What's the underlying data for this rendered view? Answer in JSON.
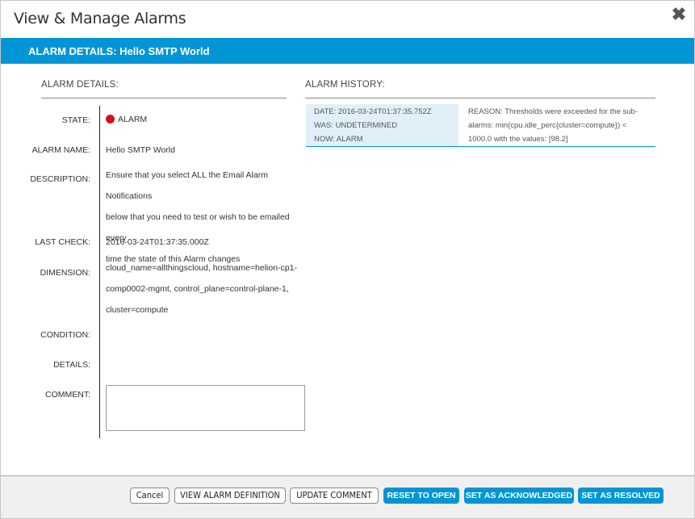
{
  "window": {
    "title": "View & Manage Alarms"
  },
  "banner": {
    "text": "ALARM DETAILS: Hello SMTP World"
  },
  "details": {
    "section_title": "ALARM DETAILS:",
    "state": {
      "label": "STATE:",
      "value": "ALARM",
      "color": "#d0131b"
    },
    "alarm_name": {
      "label": "ALARM NAME:",
      "value": "Hello SMTP World"
    },
    "description": {
      "label": "DESCRIPTION:",
      "lines": [
        "Ensure that you select ALL the Email Alarm Notifications",
        "below that you need to test or wish to be emailed every",
        "time the state of this Alarm changes"
      ]
    },
    "last_check": {
      "label": "LAST CHECK:",
      "value": "2016-03-24T01:37:35.000Z"
    },
    "dimension": {
      "label": "DIMENSION:",
      "lines": [
        "cloud_name=allthingscloud, hostname=helion-cp1-",
        "comp0002-mgmt, control_plane=control-plane-1,",
        "cluster=compute"
      ]
    },
    "condition": {
      "label": "CONDITION:",
      "value": ""
    },
    "details": {
      "label": "DETAILS:",
      "value": ""
    },
    "comment": {
      "label": "COMMENT:",
      "value": ""
    }
  },
  "history": {
    "section_title": "ALARM HISTORY:",
    "entries": [
      {
        "date": "DATE: 2016-03-24T01:37:35.752Z",
        "was": "WAS: UNDETERMINED",
        "now": "NOW: ALARM",
        "reason_lines": [
          "REASON: Thresholds were exceeded for the sub-",
          "alarms: min(cpu.idle_perc{cluster=compute}) <",
          "1000.0 with the values: [98.2]"
        ]
      }
    ]
  },
  "footer": {
    "cancel": "Cancel",
    "view_definition": "VIEW ALARM DEFINITION",
    "update_comment": "UPDATE COMMENT",
    "reset_to_open": "RESET TO OPEN",
    "set_acknowledged": "SET AS ACKNOWLEDGED",
    "set_resolved": "SET AS RESOLVED"
  },
  "colors": {
    "accent": "#0096d6",
    "alarm": "#d0131b",
    "history_highlight": "#e1f0f8"
  },
  "icons": {
    "close": "close-icon",
    "state": "alarm-state-dot-icon"
  }
}
